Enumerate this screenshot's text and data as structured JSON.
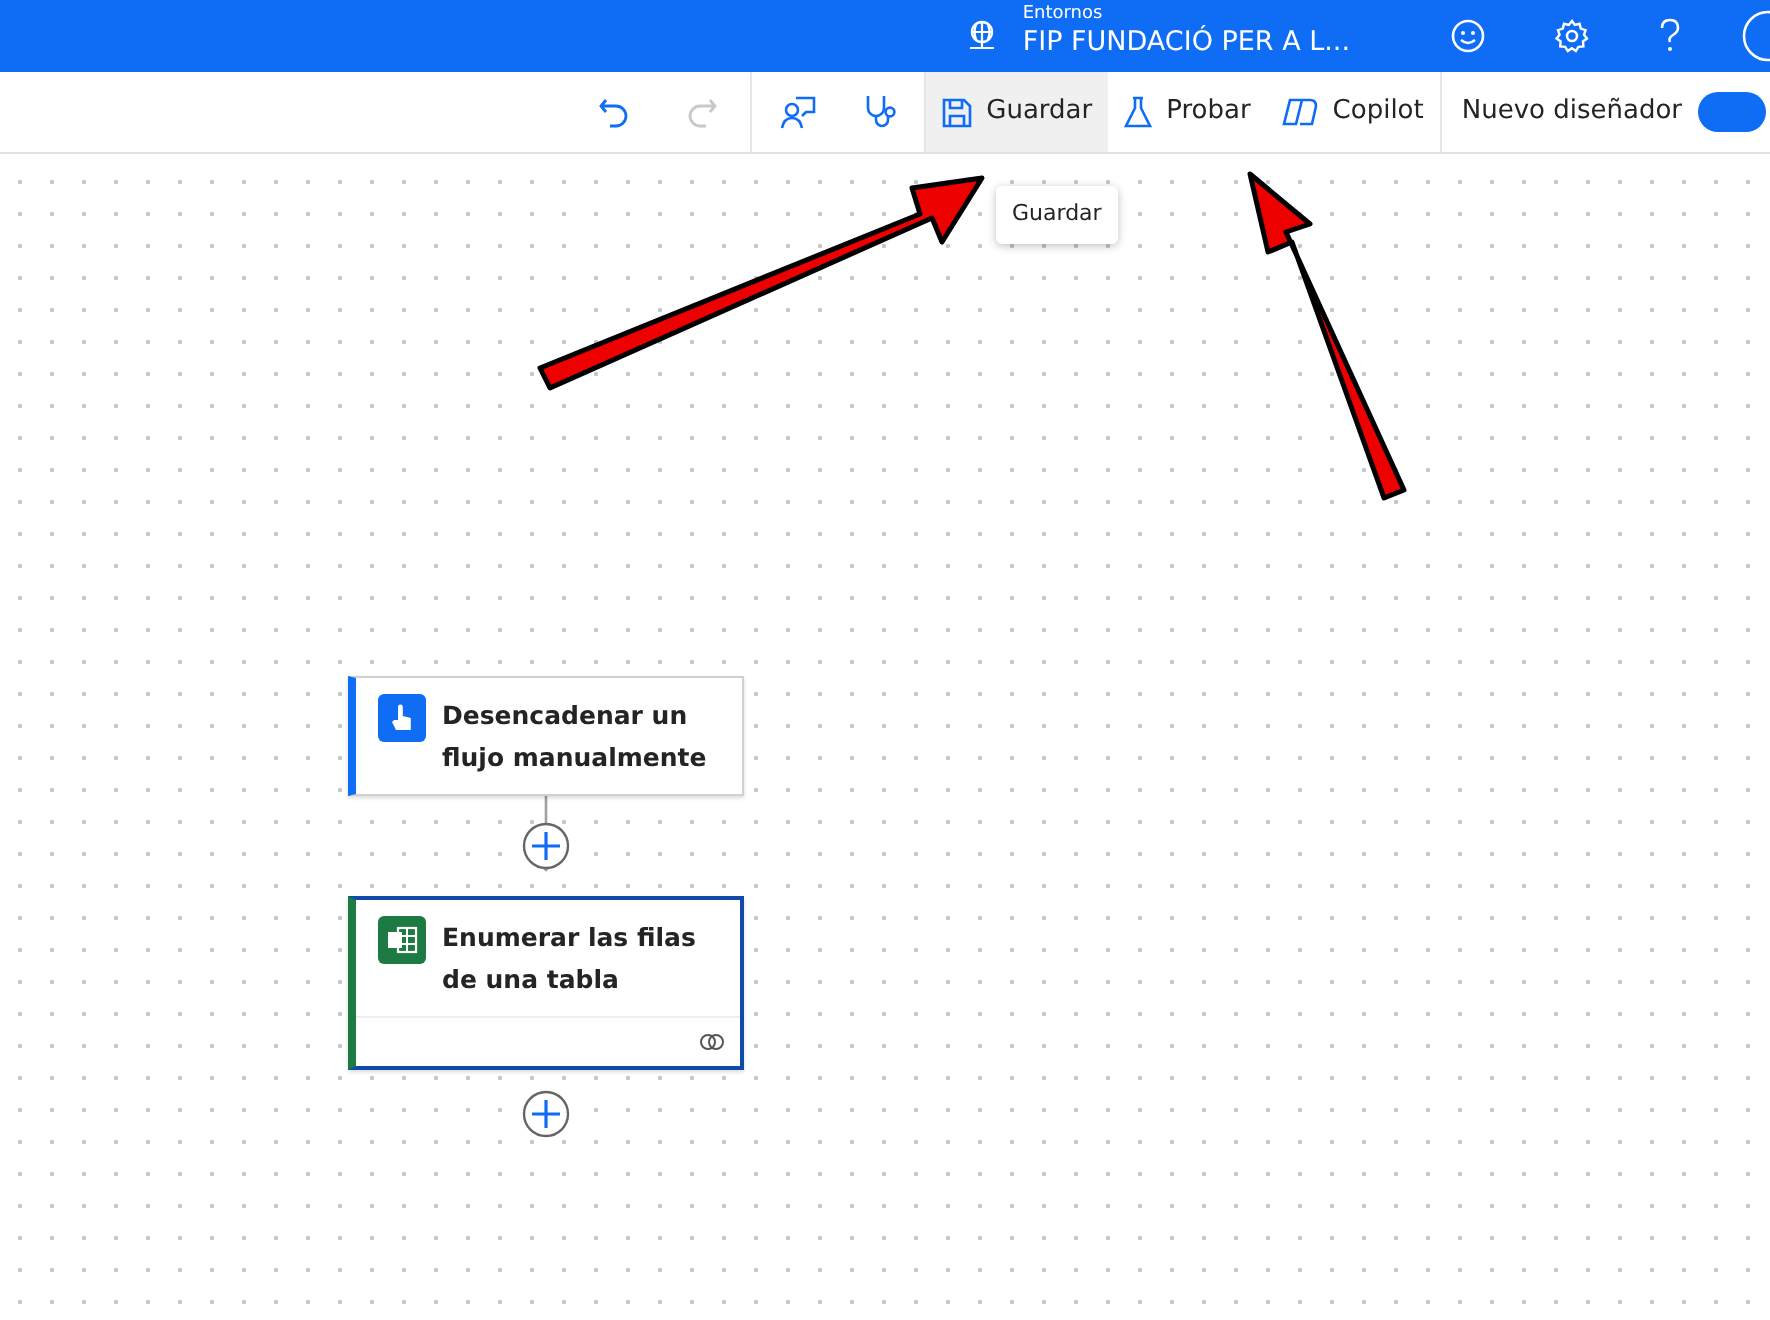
{
  "header": {
    "environment_label": "Entornos",
    "environment_name": "FIP FUNDACIÓ PER A L..."
  },
  "toolbar": {
    "save_label": "Guardar",
    "test_label": "Probar",
    "copilot_label": "Copilot",
    "new_designer_label": "Nuevo diseñador",
    "new_designer_on": true,
    "save_hovered": true
  },
  "tooltip": {
    "text": "Guardar"
  },
  "flow": [
    {
      "kind": "trigger",
      "title": "Desencadenar un flujo manualmente",
      "selected": false
    },
    {
      "kind": "excel",
      "title": "Enumerar las filas de una tabla",
      "selected": true
    }
  ]
}
